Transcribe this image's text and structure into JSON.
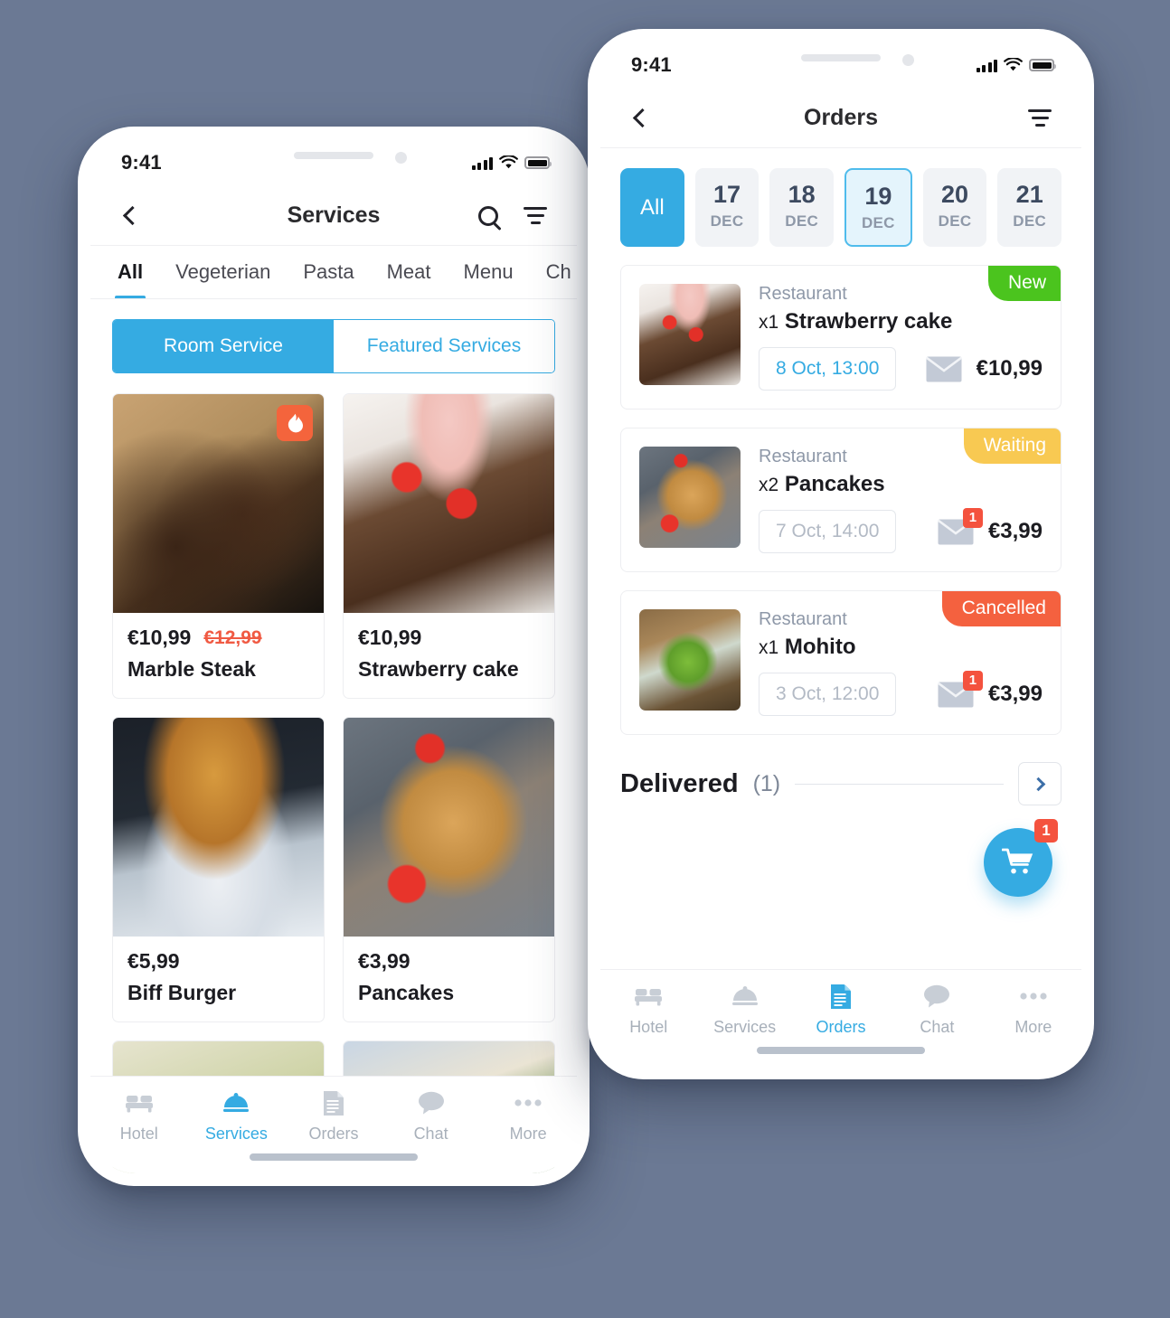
{
  "background_color": "#6B7994",
  "accent_color": "#35ABE2",
  "phones": {
    "left": {
      "status_bar": {
        "time": "9:41",
        "signal": "signal-bars-icon",
        "wifi": "wifi-icon",
        "battery": "battery-full-icon"
      },
      "header": {
        "back": "chevron-left-icon",
        "title": "Services",
        "search": "search-icon",
        "filter": "filter-icon"
      },
      "category_tabs": [
        {
          "label": "All",
          "active": true
        },
        {
          "label": "Vegeterian",
          "active": false
        },
        {
          "label": "Pasta",
          "active": false
        },
        {
          "label": "Meat",
          "active": false
        },
        {
          "label": "Menu",
          "active": false
        },
        {
          "label": "Ch",
          "active": false
        }
      ],
      "segmented": {
        "left_label": "Room Service",
        "right_label": "Featured Services",
        "selected": "Room Service"
      },
      "products": [
        {
          "price": "€10,99",
          "price_old": "€12,99",
          "name": "Marble Steak",
          "badge": "flame-icon",
          "image": "img-steak"
        },
        {
          "price": "€10,99",
          "price_old": "",
          "name": "Strawberry cake",
          "badge": "",
          "image": "img-cake"
        },
        {
          "price": "€5,99",
          "price_old": "",
          "name": "Biff Burger",
          "badge": "",
          "image": "img-burger"
        },
        {
          "price": "€3,99",
          "price_old": "",
          "name": "Pancakes",
          "badge": "",
          "image": "img-pancake"
        }
      ],
      "tabbar": [
        {
          "label": "Hotel",
          "icon": "bed-icon",
          "active": false
        },
        {
          "label": "Services",
          "icon": "room-service-bell-icon",
          "active": true
        },
        {
          "label": "Orders",
          "icon": "document-icon",
          "active": false
        },
        {
          "label": "Chat",
          "icon": "chat-bubble-icon",
          "active": false
        },
        {
          "label": "More",
          "icon": "ellipsis-icon",
          "active": false
        }
      ]
    },
    "right": {
      "status_bar": {
        "time": "9:41",
        "signal": "signal-bars-icon",
        "wifi": "wifi-icon",
        "battery": "battery-full-icon"
      },
      "header": {
        "back": "chevron-left-icon",
        "title": "Orders",
        "filter": "filter-icon"
      },
      "date_chips": [
        {
          "label": "All",
          "day": "",
          "month": "",
          "state": "all-selected"
        },
        {
          "label": "",
          "day": "17",
          "month": "DEC",
          "state": "normal"
        },
        {
          "label": "",
          "day": "18",
          "month": "DEC",
          "state": "normal"
        },
        {
          "label": "",
          "day": "19",
          "month": "DEC",
          "state": "highlighted"
        },
        {
          "label": "",
          "day": "20",
          "month": "DEC",
          "state": "normal"
        },
        {
          "label": "",
          "day": "21",
          "month": "DEC",
          "state": "normal"
        }
      ],
      "orders": [
        {
          "shop": "Restaurant",
          "qty": "x1",
          "item": "Strawberry cake",
          "time": "8 Oct, 13:00",
          "time_highlighted": true,
          "price": "€10,99",
          "status": "New",
          "status_class": "sb-new",
          "mail_badge": "",
          "image": "img-cake"
        },
        {
          "shop": "Restaurant",
          "qty": "x2",
          "item": "Pancakes",
          "time": "7 Oct, 14:00",
          "time_highlighted": false,
          "price": "€3,99",
          "status": "Waiting",
          "status_class": "sb-waiting",
          "mail_badge": "1",
          "image": "img-pancake"
        },
        {
          "shop": "Restaurant",
          "qty": "x1",
          "item": "Mohito",
          "time": "3 Oct, 12:00",
          "time_highlighted": false,
          "price": "€3,99",
          "status": "Cancelled",
          "status_class": "sb-cancelled",
          "mail_badge": "1",
          "image": "img-mohito"
        }
      ],
      "delivered": {
        "title": "Delivered",
        "count": "(1)",
        "expand": "chevron-right-icon"
      },
      "cart_fab": {
        "icon": "shopping-cart-icon",
        "badge": "1"
      },
      "tabbar": [
        {
          "label": "Hotel",
          "icon": "bed-icon",
          "active": false
        },
        {
          "label": "Services",
          "icon": "room-service-bell-icon",
          "active": false
        },
        {
          "label": "Orders",
          "icon": "document-icon",
          "active": true
        },
        {
          "label": "Chat",
          "icon": "chat-bubble-icon",
          "active": false
        },
        {
          "label": "More",
          "icon": "ellipsis-icon",
          "active": false
        }
      ]
    }
  }
}
